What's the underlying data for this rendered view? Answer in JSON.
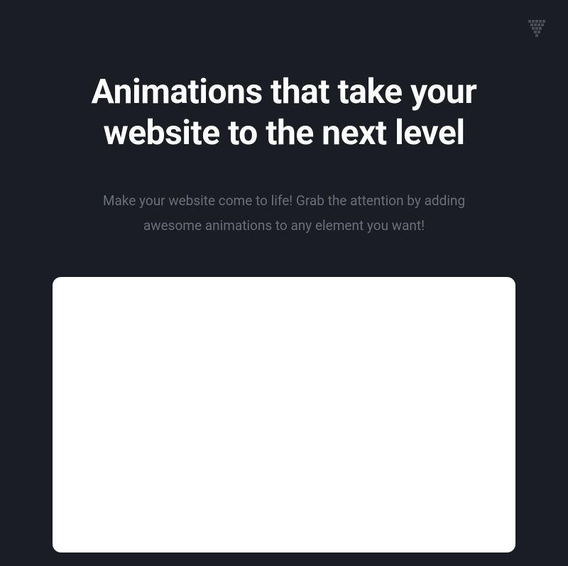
{
  "logo": {
    "name": "castle-logo"
  },
  "hero": {
    "heading": "Animations that take your website to the next level",
    "subheading": "Make your website come to life! Grab the attention by adding awesome animations to any element you want!"
  }
}
